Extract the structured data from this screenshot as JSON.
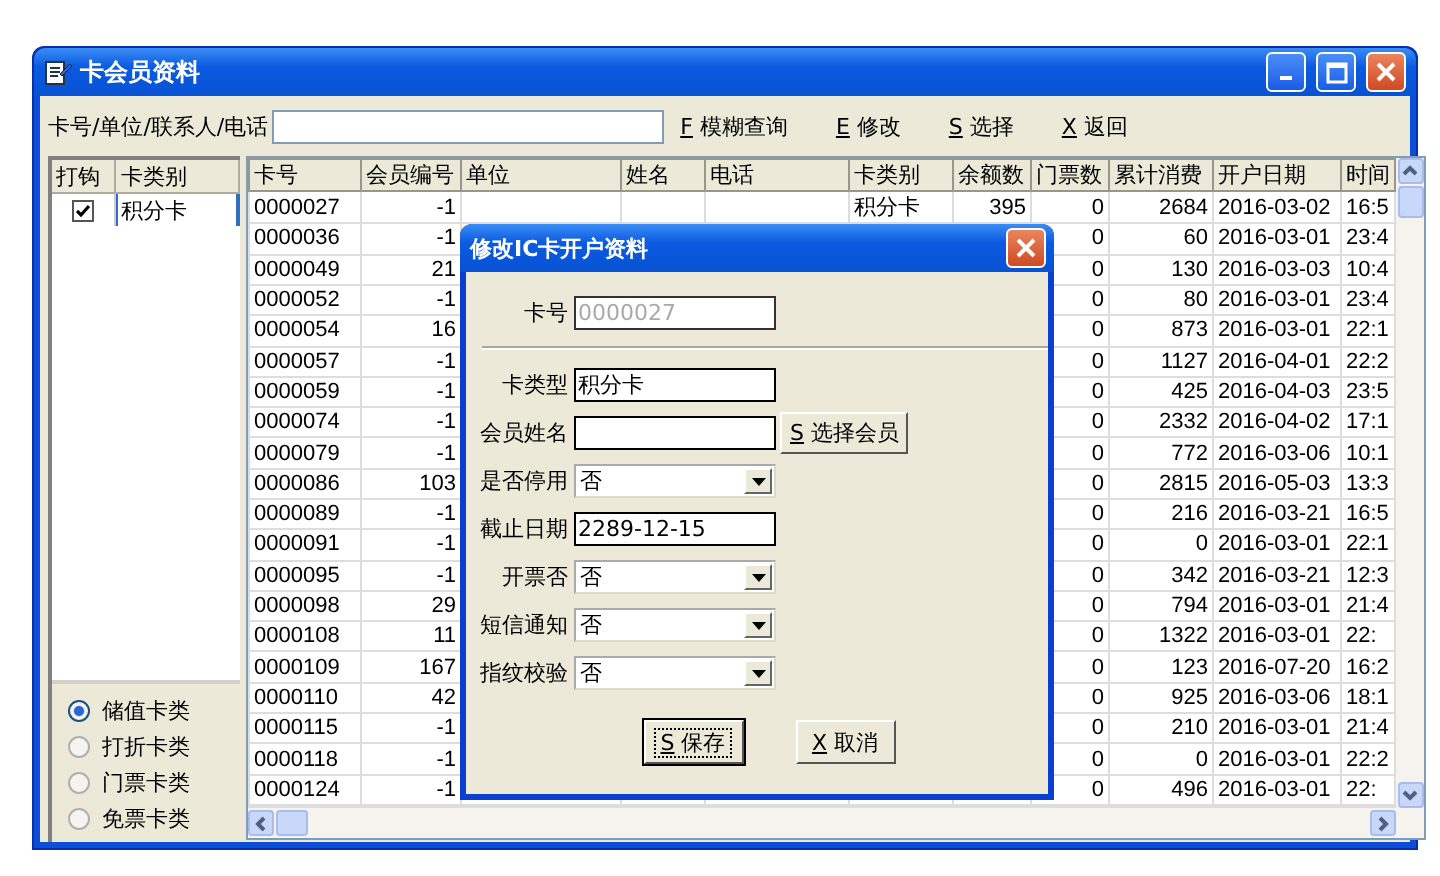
{
  "window": {
    "title": "卡会员资料"
  },
  "toolbar": {
    "search_label": "卡号/单位/联系人/电话",
    "buttons": [
      {
        "key": "F",
        "label": "模糊查询"
      },
      {
        "key": "E",
        "label": "修改"
      },
      {
        "key": "S",
        "label": "选择"
      },
      {
        "key": "X",
        "label": "返回"
      }
    ]
  },
  "card_type_table": {
    "columns": [
      "打钩",
      "卡类别"
    ],
    "rows": [
      {
        "checked": true,
        "type": "积分卡"
      }
    ]
  },
  "card_classes": [
    {
      "label": "储值卡类",
      "selected": true
    },
    {
      "label": "打折卡类",
      "selected": false
    },
    {
      "label": "门票卡类",
      "selected": false
    },
    {
      "label": "免票卡类",
      "selected": false
    }
  ],
  "table": {
    "columns": [
      "卡号",
      "会员编号",
      "单位",
      "姓名",
      "电话",
      "卡类别",
      "余额数",
      "门票数",
      "累计消费",
      "开户日期",
      "时间"
    ],
    "rows": [
      [
        "0000027",
        "-1",
        null,
        null,
        null,
        "积分卡",
        "395",
        "0",
        "2684",
        "2016-03-02",
        "16:5"
      ],
      [
        "0000036",
        "-1",
        null,
        null,
        null,
        null,
        null,
        "0",
        "60",
        "2016-03-01",
        "23:4"
      ],
      [
        "0000049",
        "21",
        null,
        null,
        null,
        null,
        null,
        "0",
        "130",
        "2016-03-03",
        "10:4"
      ],
      [
        "0000052",
        "-1",
        null,
        null,
        null,
        null,
        null,
        "0",
        "80",
        "2016-03-01",
        "23:4"
      ],
      [
        "0000054",
        "16",
        null,
        null,
        null,
        null,
        null,
        "0",
        "873",
        "2016-03-01",
        "22:1"
      ],
      [
        "0000057",
        "-1",
        null,
        null,
        null,
        null,
        null,
        "0",
        "1127",
        "2016-04-01",
        "22:2"
      ],
      [
        "0000059",
        "-1",
        null,
        null,
        null,
        null,
        null,
        "0",
        "425",
        "2016-04-03",
        "23:5"
      ],
      [
        "0000074",
        "-1",
        null,
        null,
        null,
        null,
        null,
        "0",
        "2332",
        "2016-04-02",
        "17:1"
      ],
      [
        "0000079",
        "-1",
        null,
        null,
        null,
        null,
        null,
        "0",
        "772",
        "2016-03-06",
        "10:1"
      ],
      [
        "0000086",
        "103",
        null,
        null,
        null,
        null,
        null,
        "0",
        "2815",
        "2016-05-03",
        "13:3"
      ],
      [
        "0000089",
        "-1",
        null,
        null,
        null,
        null,
        null,
        "0",
        "216",
        "2016-03-21",
        "16:5"
      ],
      [
        "0000091",
        "-1",
        null,
        null,
        null,
        null,
        null,
        "0",
        "0",
        "2016-03-01",
        "22:1"
      ],
      [
        "0000095",
        "-1",
        null,
        null,
        null,
        null,
        null,
        "0",
        "342",
        "2016-03-21",
        "12:3"
      ],
      [
        "0000098",
        "29",
        null,
        null,
        null,
        null,
        null,
        "0",
        "794",
        "2016-03-01",
        "21:4"
      ],
      [
        "0000108",
        "11",
        null,
        null,
        null,
        null,
        null,
        "0",
        "1322",
        "2016-03-01",
        "22:"
      ],
      [
        "0000109",
        "167",
        null,
        null,
        null,
        null,
        null,
        "0",
        "123",
        "2016-07-20",
        "16:2"
      ],
      [
        "0000110",
        "42",
        null,
        null,
        null,
        null,
        null,
        "0",
        "925",
        "2016-03-06",
        "18:1"
      ],
      [
        "0000115",
        "-1",
        null,
        null,
        null,
        null,
        null,
        "0",
        "210",
        "2016-03-01",
        "21:4"
      ],
      [
        "0000118",
        "-1",
        null,
        null,
        null,
        null,
        null,
        "0",
        "0",
        "2016-03-01",
        "22:2"
      ],
      [
        "0000124",
        "-1",
        null,
        null,
        null,
        null,
        null,
        "0",
        "496",
        "2016-03-01",
        "22:"
      ]
    ]
  },
  "dialog": {
    "title": "修改IC卡开户资料",
    "card_no": {
      "label": "卡号",
      "value": "0000027",
      "disabled": true
    },
    "fields": [
      {
        "label": "卡类型",
        "kind": "text",
        "value": "积分卡"
      },
      {
        "label": "会员姓名",
        "kind": "text",
        "button": {
          "key": "S",
          "label": "选择会员"
        }
      },
      {
        "label": "是否停用",
        "kind": "select",
        "value": "否"
      },
      {
        "label": "截止日期",
        "kind": "text",
        "value": "2289-12-15"
      },
      {
        "label": "开票否",
        "kind": "select",
        "value": "否"
      },
      {
        "label": "短信通知",
        "kind": "select",
        "value": "否"
      },
      {
        "label": "指纹校验",
        "kind": "select",
        "value": "否"
      }
    ],
    "buttons": [
      {
        "key": "S",
        "label": "保存",
        "focused": true
      },
      {
        "key": "X",
        "label": "取消",
        "focused": false
      }
    ]
  }
}
